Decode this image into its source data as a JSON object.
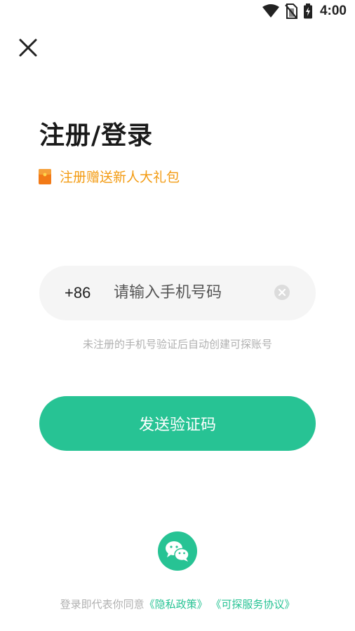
{
  "status_bar": {
    "time": "4:00",
    "icons": [
      "wifi-icon",
      "no-sim-icon",
      "battery-charging-icon"
    ]
  },
  "header": {
    "close_icon": "close-icon"
  },
  "title": "注册/登录",
  "promo": {
    "icon": "gift-icon",
    "text": "注册赠送新人大礼包",
    "color": "#f39b12"
  },
  "phone_form": {
    "country_code": "+86",
    "placeholder": "请输入手机号码",
    "value": "",
    "clear_icon": "clear-icon"
  },
  "hint": "未注册的手机号验证后自动创建可探账号",
  "send_button": {
    "label": "发送验证码",
    "color": "#27c394"
  },
  "social_login": {
    "icon": "wechat-icon"
  },
  "agreement": {
    "prefix": "登录即代表你同意",
    "privacy_link": "《隐私政策》",
    "service_link": "《可探服务协议》",
    "link_color": "#27c394"
  }
}
